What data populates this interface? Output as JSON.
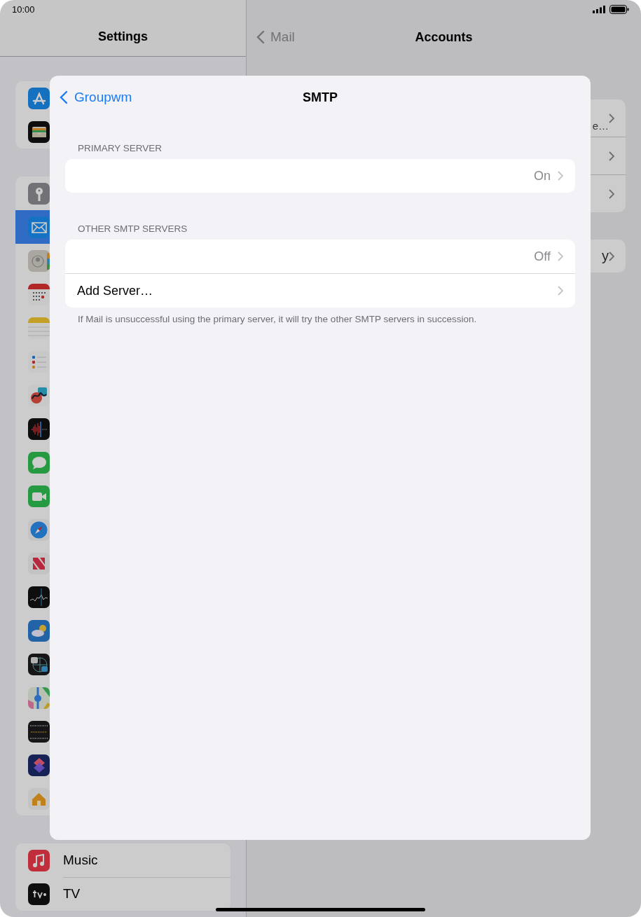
{
  "status_bar": {
    "time": "10:00"
  },
  "sidebar": {
    "title": "Settings",
    "groups": [
      {
        "items": [
          {
            "kind": "appstore",
            "selected": false
          },
          {
            "kind": "wallet",
            "selected": false
          }
        ]
      },
      {
        "items": [
          {
            "kind": "passwords",
            "selected": false
          },
          {
            "kind": "mail",
            "selected": true
          },
          {
            "kind": "contacts",
            "selected": false
          },
          {
            "kind": "calendar",
            "selected": false
          },
          {
            "kind": "notes",
            "selected": false
          },
          {
            "kind": "reminders",
            "selected": false
          },
          {
            "kind": "freeform",
            "selected": false
          },
          {
            "kind": "voicememos",
            "selected": false
          },
          {
            "kind": "messages",
            "selected": false
          },
          {
            "kind": "facetime",
            "selected": false
          },
          {
            "kind": "safari",
            "selected": false
          },
          {
            "kind": "news",
            "selected": false
          },
          {
            "kind": "stocks",
            "selected": false
          },
          {
            "kind": "weather",
            "selected": false
          },
          {
            "kind": "translate",
            "selected": false
          },
          {
            "kind": "maps",
            "selected": false
          },
          {
            "kind": "measure",
            "selected": false
          },
          {
            "kind": "shortcuts",
            "selected": false
          },
          {
            "kind": "home",
            "selected": false
          }
        ]
      },
      {
        "items": [
          {
            "kind": "music",
            "label": "Music",
            "selected": false
          },
          {
            "kind": "tv",
            "label": "TV",
            "selected": false
          }
        ]
      }
    ]
  },
  "detail": {
    "back": "Mail",
    "title": "Accounts",
    "groups": [
      {
        "rows": [
          {
            "text": "e…"
          },
          {},
          {}
        ]
      },
      {
        "rows": [
          {
            "text": "y"
          }
        ]
      }
    ]
  },
  "sheet": {
    "back": "Groupwm",
    "title": "SMTP",
    "sections": [
      {
        "header": "PRIMARY SERVER",
        "rows": [
          {
            "value": "On"
          }
        ]
      },
      {
        "header": "OTHER SMTP SERVERS",
        "rows": [
          {
            "value": "Off"
          },
          {
            "label": "Add Server…"
          }
        ],
        "footer": "If Mail is unsuccessful using the primary server, it will try the other SMTP servers in succession."
      }
    ]
  }
}
